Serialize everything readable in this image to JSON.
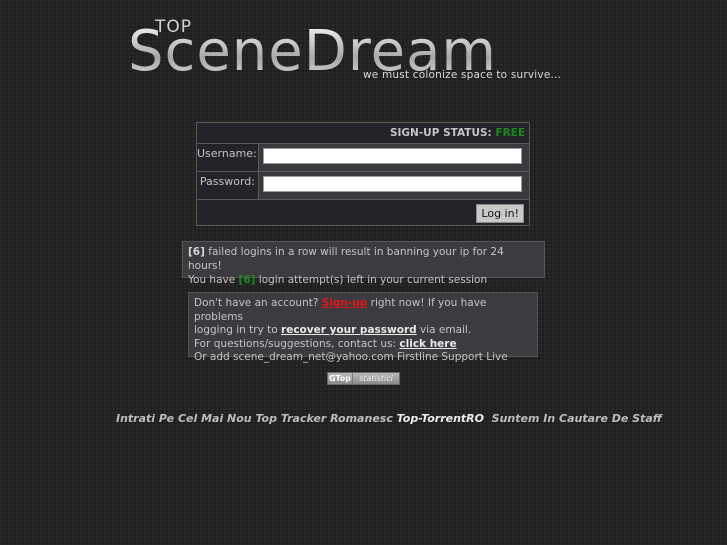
{
  "logo": {
    "top": "TOP",
    "name": "SceneDream",
    "tagline": "we must colonize space to survive..."
  },
  "login": {
    "status_label": "SIGN-UP STATUS:",
    "status_value": "FREE",
    "username_label": "Username:",
    "username_value": "",
    "password_label": "Password:",
    "password_value": "",
    "submit_label": "Log in!"
  },
  "warning": {
    "count": "[6]",
    "line1_rest": " failed logins in a row will result in banning your ip for 24 hours!",
    "line2_pre": "You have ",
    "attempts": "[6]",
    "line2_post": " login attempt(s) left in your current session"
  },
  "info": {
    "line1_pre": "Don't have an account? ",
    "signup_link": "Sign-up",
    "line1_post": " right now! If you have problems",
    "line2_pre": "logging in try to ",
    "recover_link": "recover your password",
    "line2_post": " via email.",
    "line3_pre": "For questions/suggestions, contact us: ",
    "contact_link": "click here",
    "line4": "Or add scene_dream_net@yahoo.com Firstline Support Live"
  },
  "badge": {
    "left": "GTop",
    "right": "statistici"
  },
  "footer": {
    "text_pre": "Intrati Pe Cel Mai Nou Top Tracker Romanesc ",
    "highlight": "Top-TorrentRO",
    "text_post": "  Suntem In Cautare De Staff"
  },
  "colors": {
    "status_free": "#1e8a1e",
    "signup_link": "#e21515",
    "background": "#232323"
  }
}
